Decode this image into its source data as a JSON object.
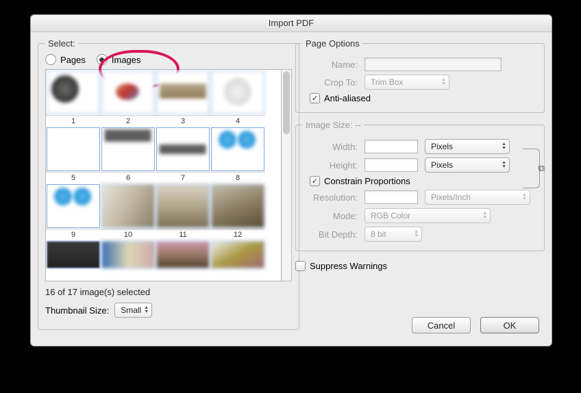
{
  "window": {
    "title": "Import PDF"
  },
  "select_panel": {
    "legend": "Select:",
    "radio_pages": "Pages",
    "radio_images": "Images",
    "selected": "images",
    "status": "16 of 17 image(s) selected",
    "thumb_label": "Thumbnail Size:",
    "thumb_value": "Small",
    "thumbs": [
      "1",
      "2",
      "3",
      "4",
      "5",
      "6",
      "7",
      "8",
      "9",
      "10",
      "11",
      "12"
    ]
  },
  "page_options": {
    "legend": "Page Options",
    "name_label": "Name:",
    "name_value": "",
    "crop_label": "Crop To:",
    "crop_value": "Trim Box",
    "antialias_label": "Anti-aliased",
    "antialias_checked": true
  },
  "image_size": {
    "legend": "Image Size: --",
    "width_label": "Width:",
    "width_value": "",
    "width_unit": "Pixels",
    "height_label": "Height:",
    "height_value": "",
    "height_unit": "Pixels",
    "constrain_label": "Constrain Proportions",
    "constrain_checked": true,
    "resolution_label": "Resolution:",
    "resolution_value": "",
    "resolution_unit": "Pixels/Inch",
    "mode_label": "Mode:",
    "mode_value": "RGB Color",
    "bitdepth_label": "Bit Depth:",
    "bitdepth_value": "8 bit"
  },
  "suppress": {
    "label": "Suppress Warnings",
    "checked": false
  },
  "buttons": {
    "cancel": "Cancel",
    "ok": "OK"
  }
}
